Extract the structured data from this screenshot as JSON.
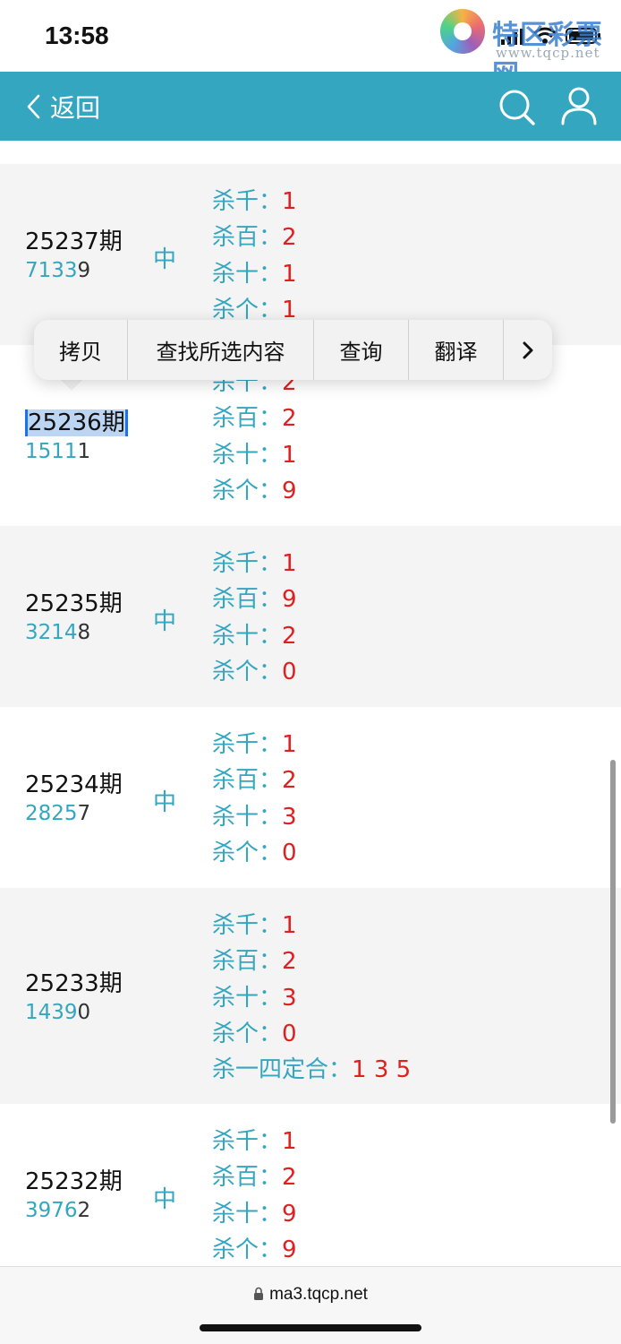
{
  "status": {
    "time": "13:58"
  },
  "watermark": {
    "title": "特区彩票网",
    "url": "www.tqcp.net"
  },
  "header": {
    "back_label": "返回"
  },
  "context_menu": {
    "items": [
      "拷贝",
      "查找所选内容",
      "查询",
      "翻译"
    ]
  },
  "rows": [
    {
      "period": "25237期",
      "nums_hi": "7133",
      "nums_last": "9",
      "mark": "中",
      "kills": [
        {
          "label": "杀千：",
          "value": "1"
        },
        {
          "label": "杀百：",
          "value": "2"
        },
        {
          "label": "杀十：",
          "value": "1"
        },
        {
          "label": "杀个：",
          "value": "1"
        }
      ]
    },
    {
      "period": "25236期",
      "nums_hi": "1511",
      "nums_last": "1",
      "mark": "",
      "kills": [
        {
          "label": "杀千：",
          "value": "2"
        },
        {
          "label": "杀百：",
          "value": "2"
        },
        {
          "label": "杀十：",
          "value": "1"
        },
        {
          "label": "杀个：",
          "value": "9"
        }
      ]
    },
    {
      "period": "25235期",
      "nums_hi": "3214",
      "nums_last": "8",
      "mark": "中",
      "kills": [
        {
          "label": "杀千：",
          "value": "1"
        },
        {
          "label": "杀百：",
          "value": "9"
        },
        {
          "label": "杀十：",
          "value": "2"
        },
        {
          "label": "杀个：",
          "value": "0"
        }
      ]
    },
    {
      "period": "25234期",
      "nums_hi": "2825",
      "nums_last": "7",
      "mark": "中",
      "kills": [
        {
          "label": "杀千：",
          "value": "1"
        },
        {
          "label": "杀百：",
          "value": "2"
        },
        {
          "label": "杀十：",
          "value": "3"
        },
        {
          "label": "杀个：",
          "value": "0"
        }
      ]
    },
    {
      "period": "25233期",
      "nums_hi": "1439",
      "nums_last": "0",
      "mark": "",
      "kills": [
        {
          "label": "杀千：",
          "value": "1"
        },
        {
          "label": "杀百：",
          "value": "2"
        },
        {
          "label": "杀十：",
          "value": "3"
        },
        {
          "label": "杀个：",
          "value": "0"
        },
        {
          "label": "杀一四定合：",
          "value": "1 3 5"
        }
      ]
    },
    {
      "period": "25232期",
      "nums_hi": "3976",
      "nums_last": "2",
      "mark": "中",
      "kills": [
        {
          "label": "杀千：",
          "value": "1"
        },
        {
          "label": "杀百：",
          "value": "2"
        },
        {
          "label": "杀十：",
          "value": "9"
        },
        {
          "label": "杀个：",
          "value": "9"
        }
      ]
    }
  ],
  "bottom": {
    "url": "ma3.tqcp.net"
  },
  "colors": {
    "accent": "#34a6c0",
    "value_red": "#e02020",
    "selection": "#1a73e8"
  }
}
